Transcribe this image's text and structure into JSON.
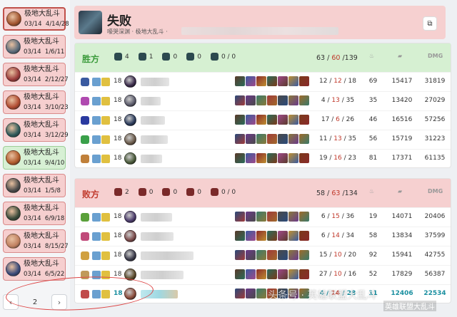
{
  "sidebar": {
    "matches": [
      {
        "mode": "极地大乱斗",
        "date": "03/14",
        "kda": "4/14/28",
        "result": "lose",
        "active": true,
        "color": "#a0522d"
      },
      {
        "mode": "极地大乱斗",
        "date": "03/14",
        "kda": "1/6/11",
        "result": "lose",
        "color": "#5a6a7a"
      },
      {
        "mode": "极地大乱斗",
        "date": "03/14",
        "kda": "2/12/27",
        "result": "lose",
        "color": "#9a3a3a"
      },
      {
        "mode": "极地大乱斗",
        "date": "03/14",
        "kda": "3/10/23",
        "result": "lose",
        "color": "#b04a30"
      },
      {
        "mode": "极地大乱斗",
        "date": "03/14",
        "kda": "3/12/29",
        "result": "lose",
        "color": "#2e5a5a"
      },
      {
        "mode": "极地大乱斗",
        "date": "03/14",
        "kda": "9/4/10",
        "result": "win",
        "color": "#b05a2a"
      },
      {
        "mode": "极地大乱斗",
        "date": "03/14",
        "kda": "1/5/8",
        "result": "lose",
        "color": "#4a4a4a"
      },
      {
        "mode": "极地大乱斗",
        "date": "03/14",
        "kda": "6/9/18",
        "result": "lose",
        "color": "#3a4a3a"
      },
      {
        "mode": "极地大乱斗",
        "date": "03/14",
        "kda": "8/15/27",
        "result": "lose",
        "color": "#c08060"
      },
      {
        "mode": "极地大乱斗",
        "date": "03/14",
        "kda": "6/5/22",
        "result": "lose",
        "color": "#3a4a7a"
      }
    ],
    "pager": {
      "prev": "‹",
      "page": "2",
      "next": "›"
    }
  },
  "header": {
    "title": "失败",
    "subtitle": "嚎哭深渊 · 极地大乱斗 ·",
    "copy_icon": "copy-icon"
  },
  "teams": [
    {
      "name": "胜方",
      "result": "win",
      "objectives": [
        "4",
        "1",
        "0",
        "0",
        "0 / 0"
      ],
      "kda_total": {
        "k": "63",
        "d": "60",
        "a": "139"
      },
      "col_headers": {
        "cs": "cs-icon",
        "gold": "gold-icon",
        "dmg": "DMG"
      },
      "players": [
        {
          "level": "18",
          "kda": {
            "k": "12",
            "d": "12",
            "a": "18"
          },
          "cs": "69",
          "gold": "15417",
          "dmg": "31819",
          "champ": "#3a5aa0",
          "avatar": "#3a2a4a",
          "nameW": 40
        },
        {
          "level": "18",
          "kda": {
            "k": "4",
            "d": "13",
            "a": "35"
          },
          "cs": "35",
          "gold": "13420",
          "dmg": "27029",
          "champ": "#b04ab0",
          "avatar": "#5a5a6a",
          "nameW": 28
        },
        {
          "level": "18",
          "kda": {
            "k": "17",
            "d": "6",
            "a": "26"
          },
          "cs": "46",
          "gold": "16516",
          "dmg": "57256",
          "champ": "#2a3aa0",
          "avatar": "#2a3a5a",
          "nameW": 34
        },
        {
          "level": "18",
          "kda": {
            "k": "11",
            "d": "13",
            "a": "35"
          },
          "cs": "56",
          "gold": "15719",
          "dmg": "31223",
          "champ": "#3aa04a",
          "avatar": "#6a5a4a",
          "nameW": 38
        },
        {
          "level": "18",
          "kda": {
            "k": "19",
            "d": "16",
            "a": "23"
          },
          "cs": "81",
          "gold": "17371",
          "dmg": "61135",
          "champ": "#c0803a",
          "avatar": "#4a5a3a",
          "nameW": 30
        }
      ]
    },
    {
      "name": "败方",
      "result": "lose",
      "objectives": [
        "2",
        "0",
        "0",
        "0",
        "0 / 0"
      ],
      "kda_total": {
        "k": "58",
        "d": "63",
        "a": "134"
      },
      "col_headers": {
        "cs": "cs-icon",
        "gold": "gold-icon",
        "dmg": "DMG"
      },
      "players": [
        {
          "level": "18",
          "kda": {
            "k": "6",
            "d": "15",
            "a": "36"
          },
          "cs": "19",
          "gold": "14071",
          "dmg": "20406",
          "champ": "#5aa03a",
          "avatar": "#4a3a6a",
          "nameW": 44
        },
        {
          "level": "18",
          "kda": {
            "k": "6",
            "d": "14",
            "a": "34"
          },
          "cs": "58",
          "gold": "13834",
          "dmg": "37599",
          "champ": "#c04a7a",
          "avatar": "#7a4a4a",
          "nameW": 46
        },
        {
          "level": "18",
          "kda": {
            "k": "15",
            "d": "10",
            "a": "20"
          },
          "cs": "92",
          "gold": "15941",
          "dmg": "42755",
          "champ": "#d0a040",
          "avatar": "#3a3a4a",
          "nameW": 74
        },
        {
          "level": "18",
          "kda": {
            "k": "27",
            "d": "10",
            "a": "16"
          },
          "cs": "52",
          "gold": "17829",
          "dmg": "56387",
          "champ": "#c09a5a",
          "avatar": "#5a4a2a",
          "nameW": 60
        },
        {
          "level": "18",
          "kda": {
            "k": "4",
            "d": "14",
            "a": "28"
          },
          "cs": "11",
          "gold": "12406",
          "dmg": "22534",
          "champ": "#c04a4a",
          "avatar": "#8a4a3a",
          "nameW": 52,
          "me": true
        }
      ]
    }
  ],
  "watermark": {
    "main": "头条号 · 英雄联盟大乱斗",
    "corner": "英雄联盟大乱斗"
  }
}
